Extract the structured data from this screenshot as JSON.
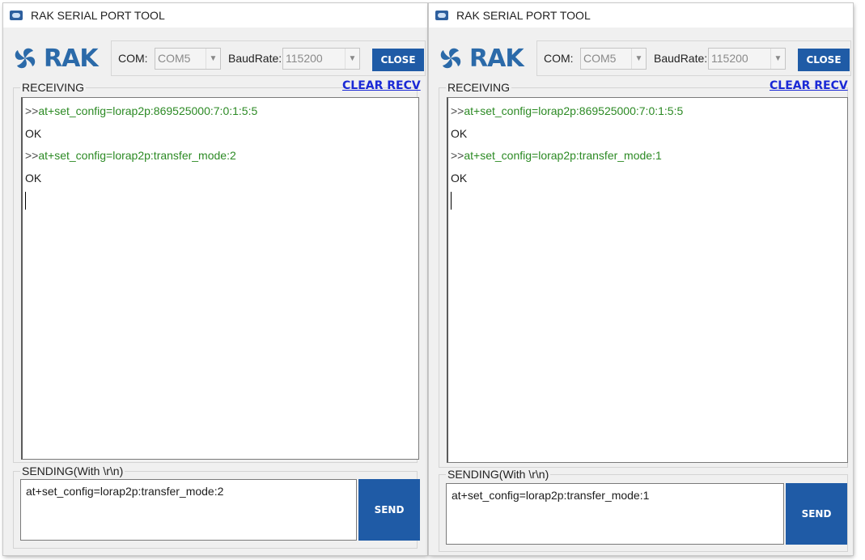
{
  "windows": [
    {
      "title": "RAK SERIAL PORT TOOL",
      "logo_text": "RAK",
      "com_label": "COM:",
      "com_value": "COM5",
      "baud_label": "BaudRate:",
      "baud_value": "115200",
      "close_label": "CLOSE",
      "receiving_label": "RECEIVING",
      "clear_label": "CLEAR RECV",
      "receive_lines": [
        {
          "prefix": ">>",
          "text": "at+set_config=lorap2p:869525000:7:0:1:5:5"
        },
        {
          "text": "OK"
        },
        {
          "prefix": ">>",
          "text": "at+set_config=lorap2p:transfer_mode:2"
        },
        {
          "text": "OK"
        }
      ],
      "sending_label": "SENDING(With \\r\\n)",
      "send_value": "at+set_config=lorap2p:transfer_mode:2",
      "send_label": "SEND"
    },
    {
      "title": "RAK SERIAL PORT TOOL",
      "logo_text": "RAK",
      "com_label": "COM:",
      "com_value": "COM5",
      "baud_label": "BaudRate:",
      "baud_value": "115200",
      "close_label": "CLOSE",
      "receiving_label": "RECEIVING",
      "clear_label": "CLEAR RECV",
      "receive_lines": [
        {
          "prefix": ">>",
          "text": "at+set_config=lorap2p:869525000:7:0:1:5:5"
        },
        {
          "text": "OK"
        },
        {
          "prefix": ">>",
          "text": "at+set_config=lorap2p:transfer_mode:1"
        },
        {
          "text": "OK"
        }
      ],
      "sending_label": "SENDING(With \\r\\n)",
      "send_value": "at+set_config=lorap2p:transfer_mode:1",
      "send_label": "SEND"
    }
  ],
  "colors": {
    "accent": "#1f5ba6",
    "logo": "#2b6aa9",
    "command_text": "#2c8a24",
    "link": "#1a29d6"
  },
  "icons": {
    "app": "serial-port-app-icon",
    "logo": "rak-logo-icon",
    "dropdown": "chevron-down-icon"
  }
}
